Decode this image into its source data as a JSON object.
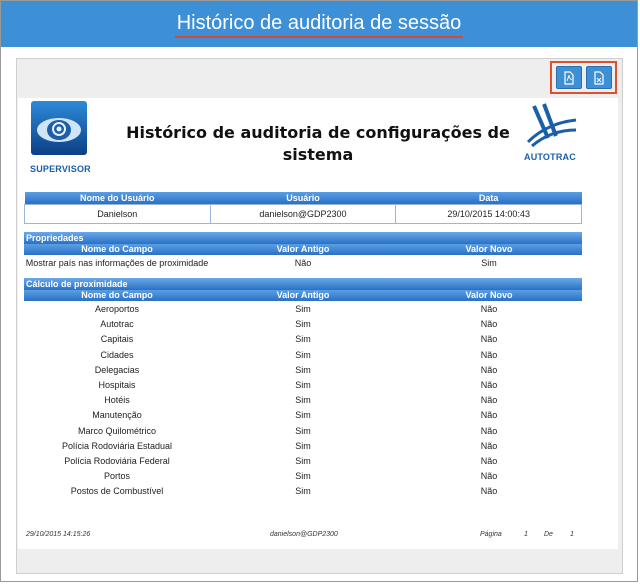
{
  "window": {
    "title": "Histórico de auditoria de sessão"
  },
  "toolbar": {
    "buttons": [
      {
        "icon": "pdf-export-icon"
      },
      {
        "icon": "excel-export-icon"
      }
    ],
    "highlight_color": "#e0502e"
  },
  "report": {
    "title": "Histórico de auditoria de configurações de sistema",
    "logo_left_caption": "SUPERVISOR",
    "logo_right_caption": "AUTOTRAC",
    "user_table": {
      "headers": [
        "Nome do Usuário",
        "Usuário",
        "Data"
      ],
      "row": [
        "Danielson",
        "danielson@GDP2300",
        "29/10/2015 14:00:43"
      ]
    },
    "sections": [
      {
        "title": "Propriedades",
        "headers": [
          "Nome do Campo",
          "Valor Antigo",
          "Valor Novo"
        ],
        "rows": [
          [
            "Mostrar país nas informações de proximidade",
            "Não",
            "Sim"
          ]
        ]
      },
      {
        "title": "Cálculo de proximidade",
        "headers": [
          "Nome do Campo",
          "Valor Antigo",
          "Valor Novo"
        ],
        "rows": [
          [
            "Aeroportos",
            "Sim",
            "Não"
          ],
          [
            "Autotrac",
            "Sim",
            "Não"
          ],
          [
            "Capitais",
            "Sim",
            "Não"
          ],
          [
            "Cidades",
            "Sim",
            "Não"
          ],
          [
            "Delegacias",
            "Sim",
            "Não"
          ],
          [
            "Hospitais",
            "Sim",
            "Não"
          ],
          [
            "Hotéis",
            "Sim",
            "Não"
          ],
          [
            "Manutenção",
            "Sim",
            "Não"
          ],
          [
            "Marco Quilométrico",
            "Sim",
            "Não"
          ],
          [
            "Polícia Rodoviária Estadual",
            "Sim",
            "Não"
          ],
          [
            "Polícia Rodoviária Federal",
            "Sim",
            "Não"
          ],
          [
            "Portos",
            "Sim",
            "Não"
          ],
          [
            "Postos de Combustível",
            "Sim",
            "Não"
          ]
        ]
      }
    ],
    "footer": {
      "timestamp": "29/10/2015 14:15:26",
      "user": "danielson@GDP2300",
      "page_label": "Página",
      "page_number": "1",
      "of_label": "De",
      "page_total": "1"
    }
  },
  "colors": {
    "title_bar": "#3d8fd6",
    "table_header": "#2a71c6"
  }
}
